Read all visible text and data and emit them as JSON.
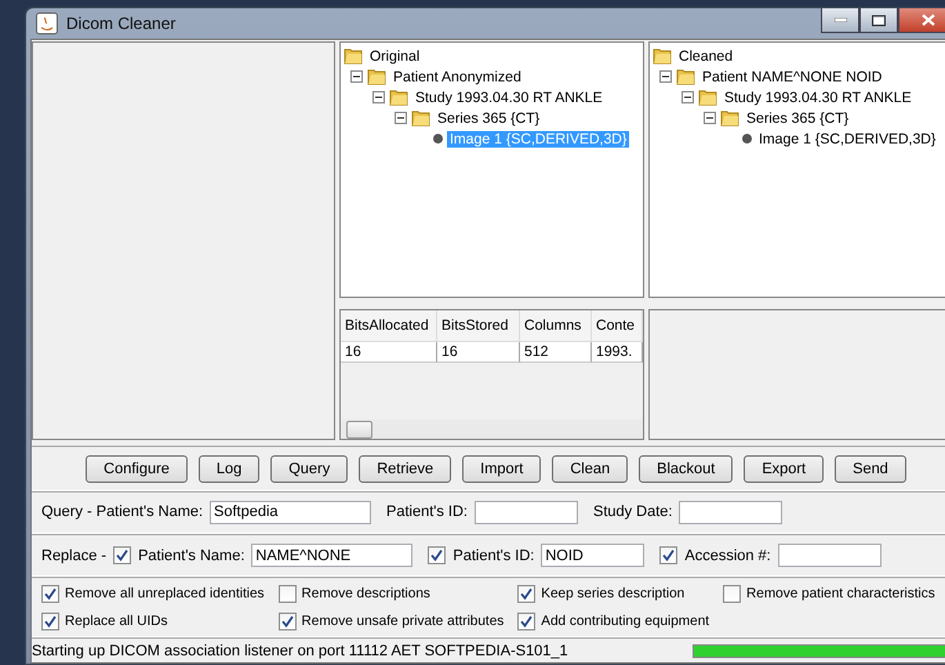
{
  "window": {
    "title": "Dicom Cleaner"
  },
  "trees": [
    {
      "root": "Original",
      "children": [
        {
          "label": "Patient Anonymized",
          "kind": "folder",
          "expanded": true,
          "selected": false,
          "children": [
            {
              "label": "Study 1993.04.30 RT ANKLE",
              "kind": "folder",
              "expanded": true,
              "selected": false,
              "children": [
                {
                  "label": "Series 365 {CT}",
                  "kind": "folder",
                  "expanded": true,
                  "selected": false,
                  "children": [
                    {
                      "label": "Image 1 {SC,DERIVED,3D}",
                      "kind": "leaf",
                      "selected": true
                    }
                  ]
                }
              ]
            }
          ]
        }
      ]
    },
    {
      "root": "Cleaned",
      "children": [
        {
          "label": "Patient NAME^NONE NOID",
          "kind": "folder",
          "expanded": true,
          "selected": false,
          "children": [
            {
              "label": "Study 1993.04.30 RT ANKLE",
              "kind": "folder",
              "expanded": true,
              "selected": false,
              "children": [
                {
                  "label": "Series 365 {CT}",
                  "kind": "folder",
                  "expanded": true,
                  "selected": false,
                  "children": [
                    {
                      "label": "Image 1 {SC,DERIVED,3D}",
                      "kind": "leaf",
                      "selected": false
                    }
                  ]
                }
              ]
            }
          ]
        }
      ]
    }
  ],
  "table": {
    "columns": [
      "BitsAllocated",
      "BitsStored",
      "Columns",
      "Conte"
    ],
    "rows": [
      [
        "16",
        "16",
        "512",
        "1993."
      ]
    ]
  },
  "buttons": [
    "Configure",
    "Log",
    "Query",
    "Retrieve",
    "Import",
    "Clean",
    "Blackout",
    "Export",
    "Send"
  ],
  "query": {
    "label": "Query - Patient's Name:",
    "fields": [
      {
        "value": "Softpedia"
      },
      {
        "label": "Patient's ID:"
      },
      {
        "label": "Study Date:"
      }
    ]
  },
  "replace": {
    "label": "Replace -",
    "fields": [
      {
        "label": "Patient's Name:",
        "checked": true,
        "value": "NAME^NONE"
      },
      {
        "label": "Patient's ID:",
        "checked": true,
        "value": "NOID"
      },
      {
        "label": "Accession #:",
        "checked": true
      }
    ]
  },
  "options": [
    {
      "label": "Remove all unreplaced identities",
      "checked": true
    },
    {
      "label": "Remove descriptions",
      "checked": false
    },
    {
      "label": "Keep series description",
      "checked": true
    },
    {
      "label": "Remove patient characteristics",
      "checked": false
    },
    {
      "label": "Replace all UIDs",
      "checked": true
    },
    {
      "label": "Remove unsafe private attributes",
      "checked": true
    },
    {
      "label": "Add contributing equipment",
      "checked": true
    }
  ],
  "status_bar": {
    "text": "Starting up DICOM association listener on port 11112 AET SOFTPEDIA-S101_1",
    "progress": {
      "level": 1
    }
  }
}
